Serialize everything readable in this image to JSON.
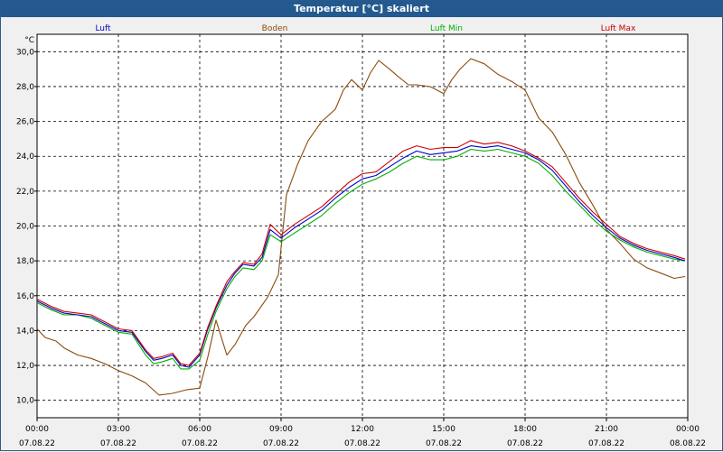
{
  "window": {
    "title": "Temperatur [°C] skaliert"
  },
  "colors": {
    "luft": "#0000cc",
    "boden": "#8b4a0c",
    "luft_min": "#00b000",
    "luft_max": "#cc0000",
    "plot_bg": "#ffffff",
    "titlebar_bg": "#23598f"
  },
  "chart_data": {
    "type": "line",
    "title": "Temperatur [°C] skaliert",
    "ylabel": "°C",
    "xlabel": "",
    "ylim": [
      9.0,
      31.0
    ],
    "xlim_hours": [
      0,
      24
    ],
    "grid": true,
    "legend_placement": "top",
    "y_ticks": [
      "10,0",
      "12,0",
      "14,0",
      "16,0",
      "18,0",
      "20,0",
      "22,0",
      "24,0",
      "26,0",
      "28,0",
      "30,0"
    ],
    "x_ticks": [
      {
        "time": "00:00",
        "date": "07.08.22"
      },
      {
        "time": "03:00",
        "date": "07.08.22"
      },
      {
        "time": "06:00",
        "date": "07.08.22"
      },
      {
        "time": "09:00",
        "date": "07.08.22"
      },
      {
        "time": "12:00",
        "date": "07.08.22"
      },
      {
        "time": "15:00",
        "date": "07.08.22"
      },
      {
        "time": "18:00",
        "date": "07.08.22"
      },
      {
        "time": "21:00",
        "date": "07.08.22"
      },
      {
        "time": "00:00",
        "date": "08.08.22"
      }
    ],
    "series": [
      {
        "name": "Luft",
        "color": "#0000cc",
        "x": [
          0,
          0.5,
          1,
          1.5,
          2,
          2.5,
          3,
          3.5,
          4,
          4.3,
          4.6,
          5,
          5.3,
          5.6,
          6,
          6.3,
          6.6,
          7,
          7.3,
          7.6,
          8,
          8.3,
          8.6,
          9,
          9.5,
          10,
          10.5,
          11,
          11.5,
          12,
          12.5,
          13,
          13.5,
          14,
          14.5,
          15,
          15.5,
          16,
          16.5,
          17,
          17.5,
          18,
          18.5,
          19,
          19.5,
          20,
          20.5,
          21,
          21.5,
          22,
          22.5,
          23,
          23.5,
          23.9
        ],
        "values": [
          15.7,
          15.3,
          15.0,
          14.9,
          14.8,
          14.4,
          14.0,
          13.9,
          12.8,
          12.3,
          12.4,
          12.6,
          12.0,
          11.9,
          12.6,
          14.1,
          15.3,
          16.6,
          17.3,
          17.8,
          17.7,
          18.2,
          19.8,
          19.3,
          19.9,
          20.4,
          20.9,
          21.6,
          22.2,
          22.7,
          22.9,
          23.4,
          23.9,
          24.3,
          24.1,
          24.2,
          24.3,
          24.6,
          24.5,
          24.6,
          24.4,
          24.2,
          23.8,
          23.2,
          22.3,
          21.4,
          20.6,
          19.9,
          19.3,
          18.9,
          18.6,
          18.4,
          18.2,
          18.0
        ]
      },
      {
        "name": "Boden",
        "color": "#8b4a0c",
        "x": [
          0,
          0.3,
          0.7,
          1,
          1.5,
          2,
          2.5,
          3,
          3.5,
          4,
          4.5,
          5,
          5.5,
          6,
          6.3,
          6.6,
          7,
          7.3,
          7.7,
          8,
          8.5,
          8.9,
          9.2,
          9.6,
          10,
          10.5,
          11,
          11.3,
          11.6,
          12,
          12.3,
          12.6,
          13,
          13.3,
          13.7,
          14,
          14.5,
          15,
          15.3,
          15.6,
          16,
          16.5,
          17,
          17.5,
          18,
          18.5,
          19,
          19.5,
          20,
          20.5,
          21,
          21.5,
          22,
          22.5,
          23,
          23.5,
          23.9
        ],
        "values": [
          14.1,
          13.6,
          13.4,
          13.0,
          12.6,
          12.4,
          12.1,
          11.7,
          11.4,
          11.0,
          10.3,
          10.4,
          10.6,
          10.7,
          12.5,
          14.6,
          12.6,
          13.2,
          14.3,
          14.8,
          15.9,
          17.2,
          21.8,
          23.5,
          24.9,
          26.0,
          26.7,
          27.8,
          28.4,
          27.8,
          28.8,
          29.5,
          29.0,
          28.6,
          28.1,
          28.1,
          28.0,
          27.6,
          28.4,
          29.0,
          29.6,
          29.3,
          28.7,
          28.3,
          27.8,
          26.2,
          25.4,
          24.1,
          22.5,
          21.2,
          19.8,
          19.0,
          18.1,
          17.6,
          17.3,
          17.0,
          17.1
        ]
      },
      {
        "name": "Luft Min",
        "color": "#00b000",
        "x": [
          0,
          0.5,
          1,
          1.5,
          2,
          2.5,
          3,
          3.5,
          4,
          4.3,
          4.6,
          5,
          5.3,
          5.6,
          6,
          6.3,
          6.6,
          7,
          7.3,
          7.6,
          8,
          8.3,
          8.6,
          9,
          9.5,
          10,
          10.5,
          11,
          11.5,
          12,
          12.5,
          13,
          13.5,
          14,
          14.5,
          15,
          15.5,
          16,
          16.5,
          17,
          17.5,
          18,
          18.5,
          19,
          19.5,
          20,
          20.5,
          21,
          21.5,
          22,
          22.5,
          23,
          23.5,
          23.9
        ],
        "values": [
          15.6,
          15.2,
          14.9,
          14.9,
          14.7,
          14.3,
          13.9,
          13.8,
          12.6,
          12.1,
          12.2,
          12.4,
          11.8,
          11.8,
          12.3,
          13.8,
          15.1,
          16.4,
          17.1,
          17.6,
          17.5,
          18.0,
          19.5,
          19.1,
          19.6,
          20.1,
          20.6,
          21.3,
          21.9,
          22.4,
          22.7,
          23.1,
          23.6,
          24.0,
          23.8,
          23.8,
          24.0,
          24.4,
          24.3,
          24.4,
          24.2,
          24.0,
          23.6,
          22.9,
          22.0,
          21.2,
          20.4,
          19.7,
          19.2,
          18.8,
          18.5,
          18.3,
          18.1,
          18.0
        ]
      },
      {
        "name": "Luft Max",
        "color": "#cc0000",
        "x": [
          0,
          0.5,
          1,
          1.5,
          2,
          2.5,
          3,
          3.5,
          4,
          4.3,
          4.6,
          5,
          5.3,
          5.6,
          6,
          6.3,
          6.6,
          7,
          7.3,
          7.6,
          8,
          8.3,
          8.6,
          9,
          9.5,
          10,
          10.5,
          11,
          11.5,
          12,
          12.5,
          13,
          13.5,
          14,
          14.5,
          15,
          15.5,
          16,
          16.5,
          17,
          17.5,
          18,
          18.5,
          19,
          19.5,
          20,
          20.5,
          21,
          21.5,
          22,
          22.5,
          23,
          23.5,
          23.9
        ],
        "values": [
          15.8,
          15.4,
          15.1,
          15.0,
          14.9,
          14.5,
          14.1,
          14.0,
          12.9,
          12.4,
          12.5,
          12.7,
          12.1,
          12.0,
          12.7,
          14.2,
          15.4,
          16.8,
          17.4,
          17.9,
          17.8,
          18.4,
          20.1,
          19.5,
          20.1,
          20.6,
          21.1,
          21.8,
          22.5,
          23.0,
          23.1,
          23.7,
          24.3,
          24.6,
          24.4,
          24.5,
          24.5,
          24.9,
          24.7,
          24.8,
          24.6,
          24.3,
          23.9,
          23.4,
          22.5,
          21.6,
          20.8,
          20.1,
          19.4,
          19.0,
          18.7,
          18.5,
          18.3,
          18.1
        ]
      }
    ]
  }
}
